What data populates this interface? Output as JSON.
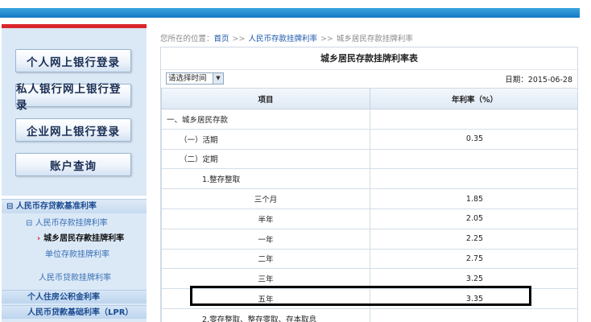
{
  "left_nav": {
    "login_buttons": [
      {
        "label": "个人网上银行登录"
      },
      {
        "label": "私人银行网上银行登录"
      },
      {
        "label": "企业网上银行登录"
      },
      {
        "label": "账户查询"
      }
    ],
    "menu": {
      "category_loan_deposit": "人民币存贷款基准利率",
      "category_collapse_icon": "⊟",
      "deposit_sub_icon": "⊟",
      "deposit_sub": "人民币存款挂牌利率",
      "active_item_arrow": "›",
      "active_item": "城乡居民存款挂牌利率",
      "unit_item": "单位存款挂牌利率",
      "loan_item": "人民币贷款挂牌利率",
      "housing_fund": "个人住房公积金利率",
      "lpr": "人民币贷款基础利率（LPR）"
    }
  },
  "breadcrumb": {
    "prefix": "您所在的位置：",
    "home": "首页",
    "separator": ">>",
    "level2": "人民币存款挂牌利率",
    "current": "城乡居民存款挂牌利率"
  },
  "panel": {
    "title": "城乡居民存款挂牌利率表",
    "select_value": "请选择时间",
    "date_label": "日期：",
    "date_value": "2015-06-28"
  },
  "table": {
    "headers": [
      "项目",
      "年利率（%）"
    ],
    "rows": [
      {
        "item": "一、城乡居民存款",
        "rate": "",
        "indent": 0
      },
      {
        "item": "（一）活期",
        "rate": "0.35",
        "indent": 1
      },
      {
        "item": "（二）定期",
        "rate": "",
        "indent": 1
      },
      {
        "item": "1.整存整取",
        "rate": "",
        "indent": 2
      },
      {
        "item": "三个月",
        "rate": "1.85",
        "indent": 3
      },
      {
        "item": "半年",
        "rate": "2.05",
        "indent": 3
      },
      {
        "item": "一年",
        "rate": "2.25",
        "indent": 3
      },
      {
        "item": "二年",
        "rate": "2.75",
        "indent": 3
      },
      {
        "item": "三年",
        "rate": "3.25",
        "indent": 3
      },
      {
        "item": "五年",
        "rate": "3.35",
        "indent": 3
      },
      {
        "item": "2.零存整取、整存零取、存本取息",
        "rate": "",
        "indent": 2
      }
    ]
  },
  "colors": {
    "top_bar": "#1478c4",
    "accent_red": "#d9262b",
    "sidebar_bg": "#dbe9f7",
    "link_blue": "#1a56a8",
    "highlight_box": "#000000"
  }
}
